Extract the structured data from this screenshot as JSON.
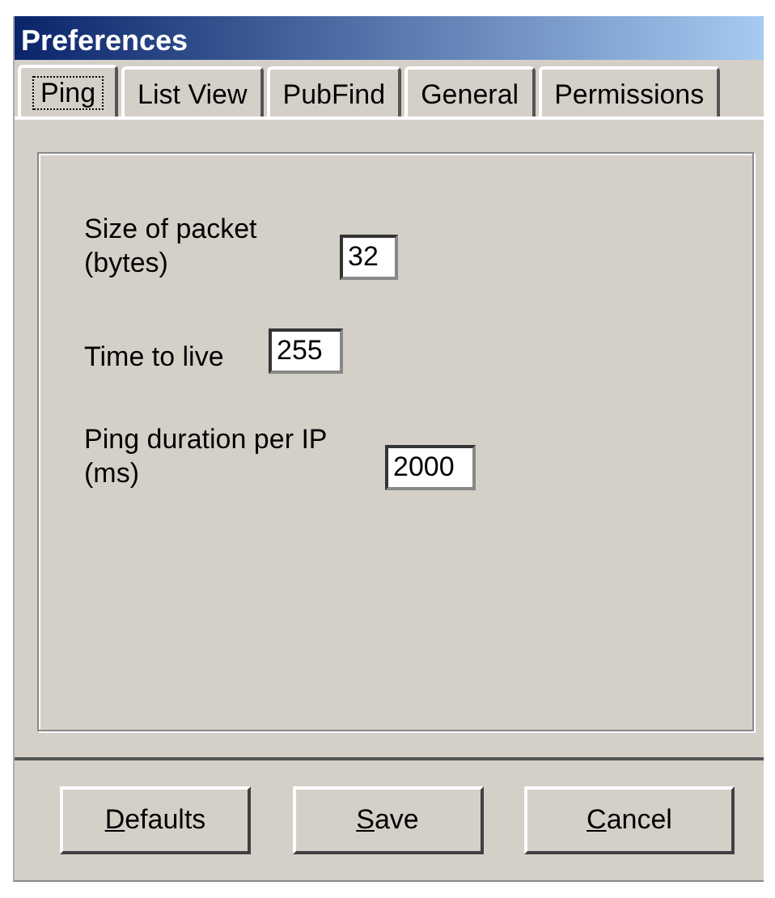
{
  "window": {
    "title": "Preferences"
  },
  "tabs": [
    {
      "label": "Ping",
      "selected": true
    },
    {
      "label": "List View",
      "selected": false
    },
    {
      "label": "PubFind",
      "selected": false
    },
    {
      "label": "General",
      "selected": false
    },
    {
      "label": "Permissions",
      "selected": false
    }
  ],
  "fields": [
    {
      "label": "Size of packet\n(bytes)",
      "value": "32"
    },
    {
      "label": "Time to live",
      "value": "255"
    },
    {
      "label": "Ping duration per IP\n(ms)",
      "value": "2000"
    }
  ],
  "buttons": [
    {
      "access_key": "D",
      "rest": "efaults"
    },
    {
      "access_key": "S",
      "rest": "ave"
    },
    {
      "access_key": "C",
      "rest": "ancel"
    }
  ]
}
